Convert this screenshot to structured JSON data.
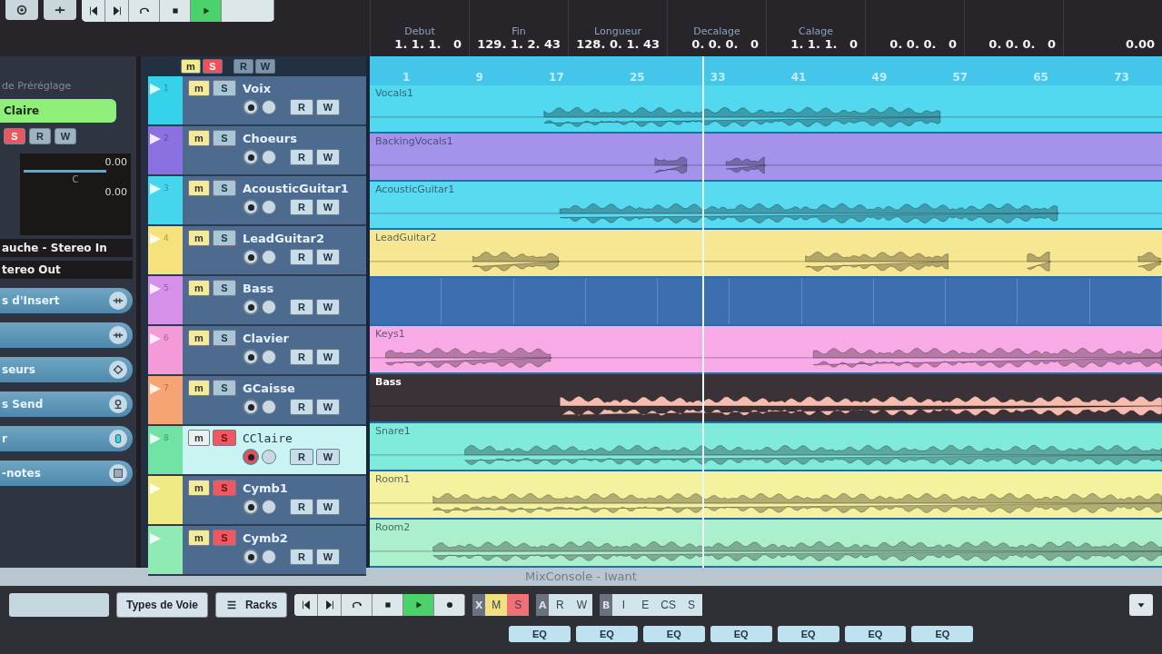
{
  "toolbar": {
    "buttons": [
      {
        "kind": "settings"
      },
      {
        "kind": "snap"
      }
    ],
    "transport": [
      {
        "kind": "prev",
        "on": false
      },
      {
        "kind": "next",
        "on": false
      },
      {
        "kind": "loop",
        "on": false
      },
      {
        "kind": "stop",
        "on": false
      },
      {
        "kind": "play",
        "on": true
      },
      {
        "kind": "blank",
        "on": false
      }
    ]
  },
  "info_line": [
    {
      "label": "Debut",
      "value": "1. 1. 1.   0"
    },
    {
      "label": "Fin",
      "value": "129. 1. 2. 43"
    },
    {
      "label": "Longueur",
      "value": "128. 0. 1. 43"
    },
    {
      "label": "Decalage",
      "value": "0. 0. 0.   0"
    },
    {
      "label": "Calage",
      "value": "1. 1. 1.   0"
    },
    {
      "value": "0. 0. 0.   0"
    },
    {
      "value": "0. 0. 0.   0"
    },
    {
      "value": "0.00"
    }
  ],
  "inspector": {
    "preset_label": "de Préréglage",
    "track_name": "Claire",
    "buttons": [
      {
        "label": "S",
        "on": true
      },
      {
        "label": "R",
        "on": false
      },
      {
        "label": "W",
        "on": false
      }
    ],
    "volume": "0.00",
    "pan_label": "C",
    "pan": "0.00",
    "input": "auche - Stereo In",
    "output": "tereo Out",
    "sections": [
      {
        "label": "s d'Insert",
        "kind": "plug"
      },
      {
        "kind": "plug"
      },
      {
        "label": "seurs",
        "kind": "diamond"
      },
      {
        "label": "s Send",
        "kind": "send"
      },
      {
        "label": "r",
        "kind": "fader"
      },
      {
        "label": "-notes",
        "kind": "note"
      }
    ]
  },
  "track_header": [
    {
      "label": "m",
      "on": true,
      "kind": "mute"
    },
    {
      "label": "S",
      "on": true,
      "kind": "solo"
    },
    {
      "label": "R",
      "on": false,
      "kind": "read"
    },
    {
      "label": "W",
      "on": false,
      "kind": "write"
    }
  ],
  "tracks": [
    {
      "number": "1",
      "name": "Voix",
      "color": "#36d2ea",
      "solo": false,
      "record": false,
      "selected": false,
      "m_button": "m",
      "s_button": "S",
      "r_button": "R",
      "w_button": "W"
    },
    {
      "number": "2",
      "name": "Choeurs",
      "color": "#8a70e0",
      "solo": false,
      "record": false,
      "selected": false,
      "m_button": "m",
      "s_button": "S",
      "r_button": "R",
      "w_button": "W"
    },
    {
      "number": "3",
      "name": "AcousticGuitar1",
      "color": "#45d5ec",
      "solo": false,
      "record": false,
      "selected": false,
      "m_button": "m",
      "s_button": "S",
      "r_button": "R",
      "w_button": "W"
    },
    {
      "number": "4",
      "name": "LeadGuitar2",
      "color": "#f6e27c",
      "solo": false,
      "record": false,
      "selected": false,
      "m_button": "m",
      "s_button": "S",
      "r_button": "R",
      "w_button": "W"
    },
    {
      "number": "5",
      "name": "Bass",
      "color": "#d690ea",
      "solo": false,
      "record": false,
      "selected": false,
      "m_button": "m",
      "s_button": "S",
      "r_button": "R",
      "w_button": "W"
    },
    {
      "number": "6",
      "name": "Clavier",
      "color": "#f59ad8",
      "solo": false,
      "record": false,
      "selected": false,
      "m_button": "m",
      "s_button": "S",
      "r_button": "R",
      "w_button": "W"
    },
    {
      "number": "7",
      "name": "GCaisse",
      "color": "#f6a474",
      "solo": false,
      "record": false,
      "selected": false,
      "m_button": "m",
      "s_button": "S",
      "r_button": "R",
      "w_button": "W"
    },
    {
      "number": "8",
      "name": "CClaire",
      "color": "#70e2a4",
      "solo": true,
      "record": true,
      "selected": true,
      "m_button": "m",
      "s_button": "S",
      "r_button": "R",
      "w_button": "W"
    },
    {
      "name": "Cymb1",
      "color": "#efea84",
      "solo": true,
      "record": false,
      "selected": false,
      "m_button": "m",
      "s_button": "S",
      "r_button": "R",
      "w_button": "W"
    },
    {
      "name": "Cymb2",
      "color": "#90eab4",
      "solo": true,
      "record": false,
      "selected": false,
      "m_button": "m",
      "s_button": "S",
      "r_button": "R",
      "w_button": "W"
    }
  ],
  "ruler": [
    "1",
    "9",
    "17",
    "25",
    "33",
    "41",
    "49",
    "57",
    "65",
    "73"
  ],
  "lanes": [
    {
      "kind": "audio",
      "name": "Vocals1",
      "color": "#52d8ef",
      "selected": false
    },
    {
      "kind": "audio",
      "name": "BackingVocals1",
      "color": "#a592ea",
      "selected": false
    },
    {
      "kind": "audio",
      "name": "AcousticGuitar1",
      "color": "#58daf1",
      "selected": false
    },
    {
      "kind": "audio",
      "name": "LeadGuitar2",
      "color": "#f7e792",
      "selected": false
    },
    {
      "kind": "empty",
      "color": "#3d6fb0",
      "selected": false
    },
    {
      "kind": "audio",
      "name": "Keys1",
      "color": "#f8aae6",
      "selected": false
    },
    {
      "kind": "audio",
      "name": "Bass",
      "color": "#f6bcae",
      "selected": true
    },
    {
      "kind": "audio",
      "name": "Snare1",
      "color": "#80eadb",
      "selected": false
    },
    {
      "kind": "audio",
      "name": "Room1",
      "color": "#f4f29e",
      "selected": false
    },
    {
      "kind": "audio",
      "name": "Room2",
      "color": "#acefcc",
      "selected": false
    }
  ],
  "mixconsole": {
    "title": "MixConsole - Iwant",
    "types_button": "Types de Voie",
    "racks_button": "Racks",
    "transport": [
      {
        "kind": "prev",
        "on": false
      },
      {
        "kind": "next",
        "on": false
      },
      {
        "kind": "loop",
        "on": false
      },
      {
        "kind": "stop",
        "on": false
      },
      {
        "kind": "play",
        "on": true
      },
      {
        "kind": "record",
        "on": false
      }
    ],
    "groups": [
      {
        "tag": "X",
        "buttons": [
          {
            "label": "M",
            "on": true,
            "kind": "mute"
          },
          {
            "label": "S",
            "on": true,
            "kind": "solo"
          }
        ]
      },
      {
        "tag": "A",
        "buttons": [
          {
            "label": "R",
            "on": false,
            "kind": "read"
          },
          {
            "label": "W",
            "on": false,
            "kind": "write"
          }
        ]
      },
      {
        "tag": "B",
        "buttons": [
          {
            "label": "I",
            "on": false,
            "kind": "plain"
          },
          {
            "label": "E",
            "on": false,
            "kind": "plain"
          },
          {
            "label": "CS",
            "on": false,
            "kind": "plain"
          },
          {
            "label": "S",
            "on": false,
            "kind": "plain"
          }
        ]
      }
    ],
    "eq_buttons": [
      "EQ",
      "EQ",
      "EQ",
      "EQ",
      "EQ",
      "EQ",
      "EQ"
    ]
  }
}
